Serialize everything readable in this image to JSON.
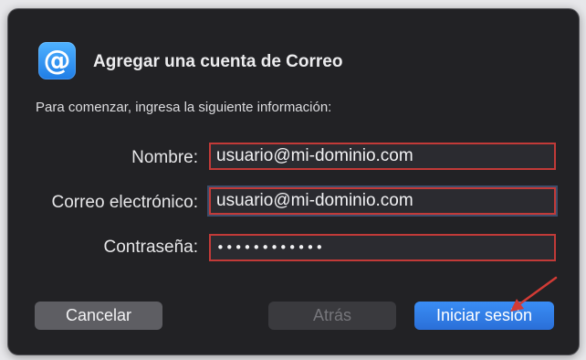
{
  "dialog": {
    "icon": "at-sign-mail-icon",
    "icon_glyph": "@",
    "title": "Agregar una cuenta de Correo",
    "intro": "Para comenzar, ingresa la siguiente información:"
  },
  "form": {
    "name_label": "Nombre:",
    "name_value": "usuario@mi-dominio.com",
    "email_label": "Correo electrónico:",
    "email_value": "usuario@mi-dominio.com",
    "password_label": "Contraseña:",
    "password_value": "••••••••••••"
  },
  "buttons": {
    "cancel": "Cancelar",
    "back": "Atrás",
    "sign_in": "Iniciar sesión"
  },
  "colors": {
    "highlight_border": "#c23a38",
    "annotation_arrow": "#d23b35",
    "primary_button": "#2a6fd8"
  }
}
